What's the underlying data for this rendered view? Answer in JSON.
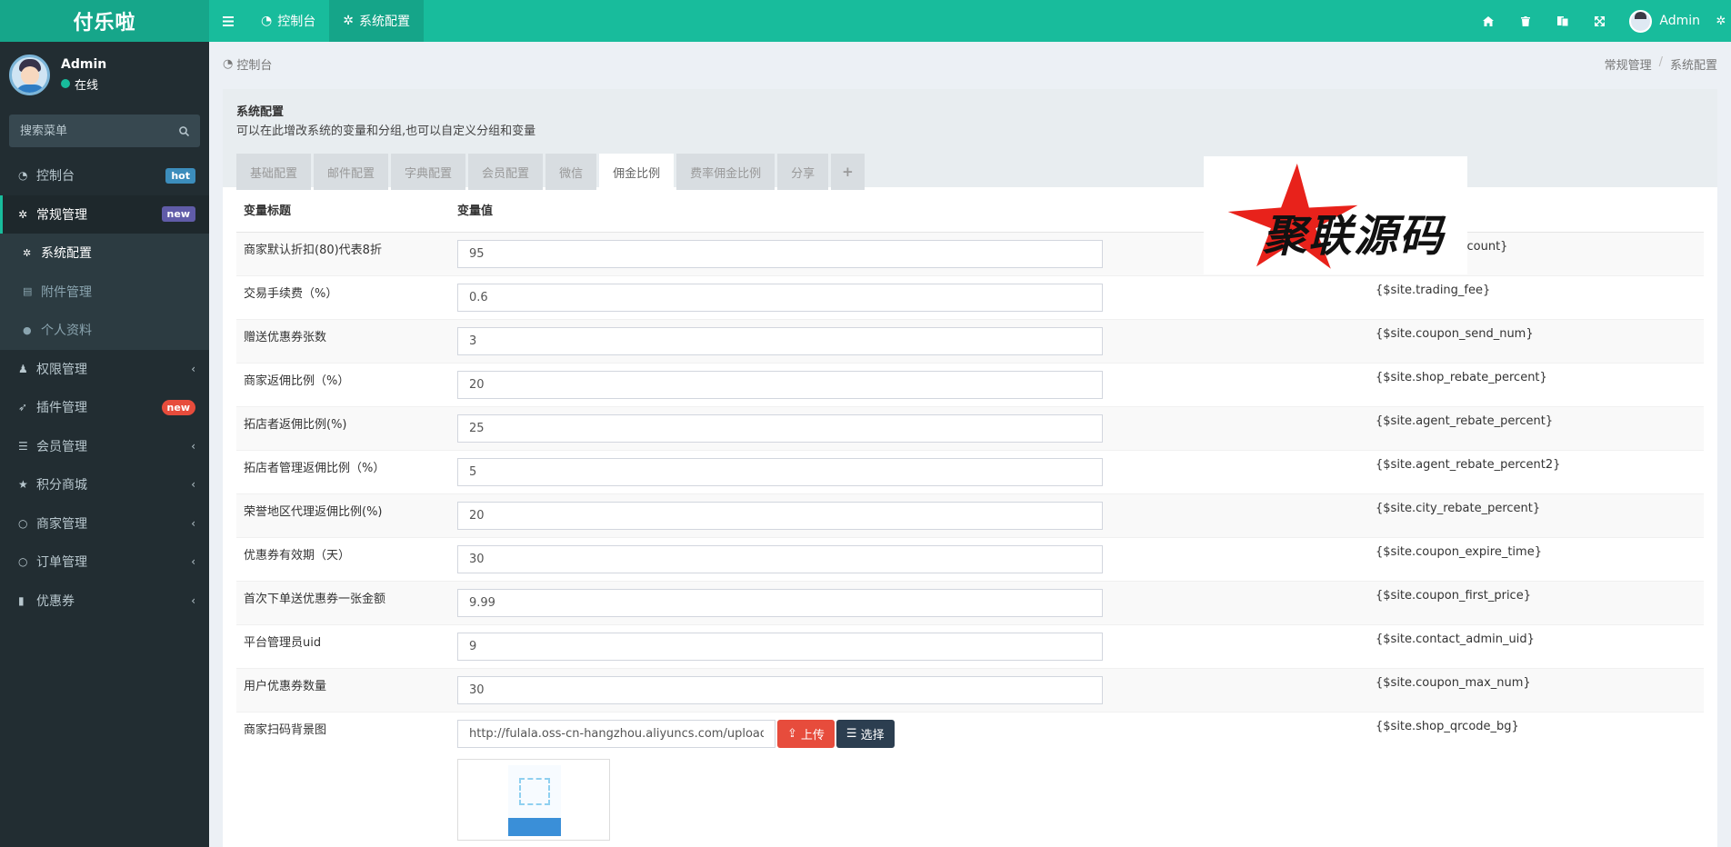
{
  "header": {
    "logo": "付乐啦",
    "nav": [
      {
        "label": "控制台",
        "icon": "dashboard-icon"
      },
      {
        "label": "系统配置",
        "icon": "gear-icon"
      }
    ],
    "user_name": "Admin",
    "colors": {
      "primary": "#18bc9c",
      "sidebar": "#222d32"
    }
  },
  "sidebar": {
    "user_name": "Admin",
    "status": "在线",
    "search_placeholder": "搜索菜单",
    "items": [
      {
        "label": "控制台",
        "badge": "hot"
      },
      {
        "label": "常规管理",
        "badge": "new"
      },
      {
        "label": "系统配置"
      },
      {
        "label": "附件管理"
      },
      {
        "label": "个人资料"
      },
      {
        "label": "权限管理"
      },
      {
        "label": "插件管理",
        "badge": "new"
      },
      {
        "label": "会员管理"
      },
      {
        "label": "积分商城"
      },
      {
        "label": "商家管理"
      },
      {
        "label": "订单管理"
      },
      {
        "label": "优惠券"
      }
    ]
  },
  "breadcrumb": {
    "left": "控制台",
    "right": [
      "常规管理",
      "/",
      "系统配置"
    ]
  },
  "panel": {
    "title": "系统配置",
    "description": "可以在此增改系统的变量和分组,也可以自定义分组和变量",
    "tabs": [
      "基础配置",
      "邮件配置",
      "字典配置",
      "会员配置",
      "微信",
      "佣金比例",
      "费率佣金比例",
      "分享",
      "+"
    ],
    "columns": [
      "变量标题",
      "变量值",
      "变量名"
    ],
    "rows": [
      {
        "title": "商家默认折扣(80)代表8折",
        "value": "95",
        "name": "{$site.shop_discount}"
      },
      {
        "title": "交易手续费（%）",
        "value": "0.6",
        "name": "{$site.trading_fee}"
      },
      {
        "title": "赠送优惠券张数",
        "value": "3",
        "name": "{$site.coupon_send_num}"
      },
      {
        "title": "商家返佣比例（%）",
        "value": "20",
        "name": "{$site.shop_rebate_percent}"
      },
      {
        "title": "拓店者返佣比例(%)",
        "value": "25",
        "name": "{$site.agent_rebate_percent}"
      },
      {
        "title": "拓店者管理返佣比例（%）",
        "value": "5",
        "name": "{$site.agent_rebate_percent2}"
      },
      {
        "title": "荣誉地区代理返佣比例(%)",
        "value": "20",
        "name": "{$site.city_rebate_percent}"
      },
      {
        "title": "优惠券有效期（天）",
        "value": "30",
        "name": "{$site.coupon_expire_time}"
      },
      {
        "title": "首次下单送优惠券一张金额",
        "value": "9.99",
        "name": "{$site.coupon_first_price}"
      },
      {
        "title": "平台管理员uid",
        "value": "9",
        "name": "{$site.contact_admin_uid}"
      },
      {
        "title": "用户优惠券数量",
        "value": "30",
        "name": "{$site.coupon_max_num}"
      }
    ],
    "image_row": {
      "title": "商家扫码背景图",
      "value": "http://fulala.oss-cn-hangzhou.aliyuncs.com/uploads/20201009",
      "name": "{$site.shop_qrcode_bg}",
      "upload_label": "上传",
      "select_label": "选择"
    }
  },
  "watermark": "聚联源码"
}
